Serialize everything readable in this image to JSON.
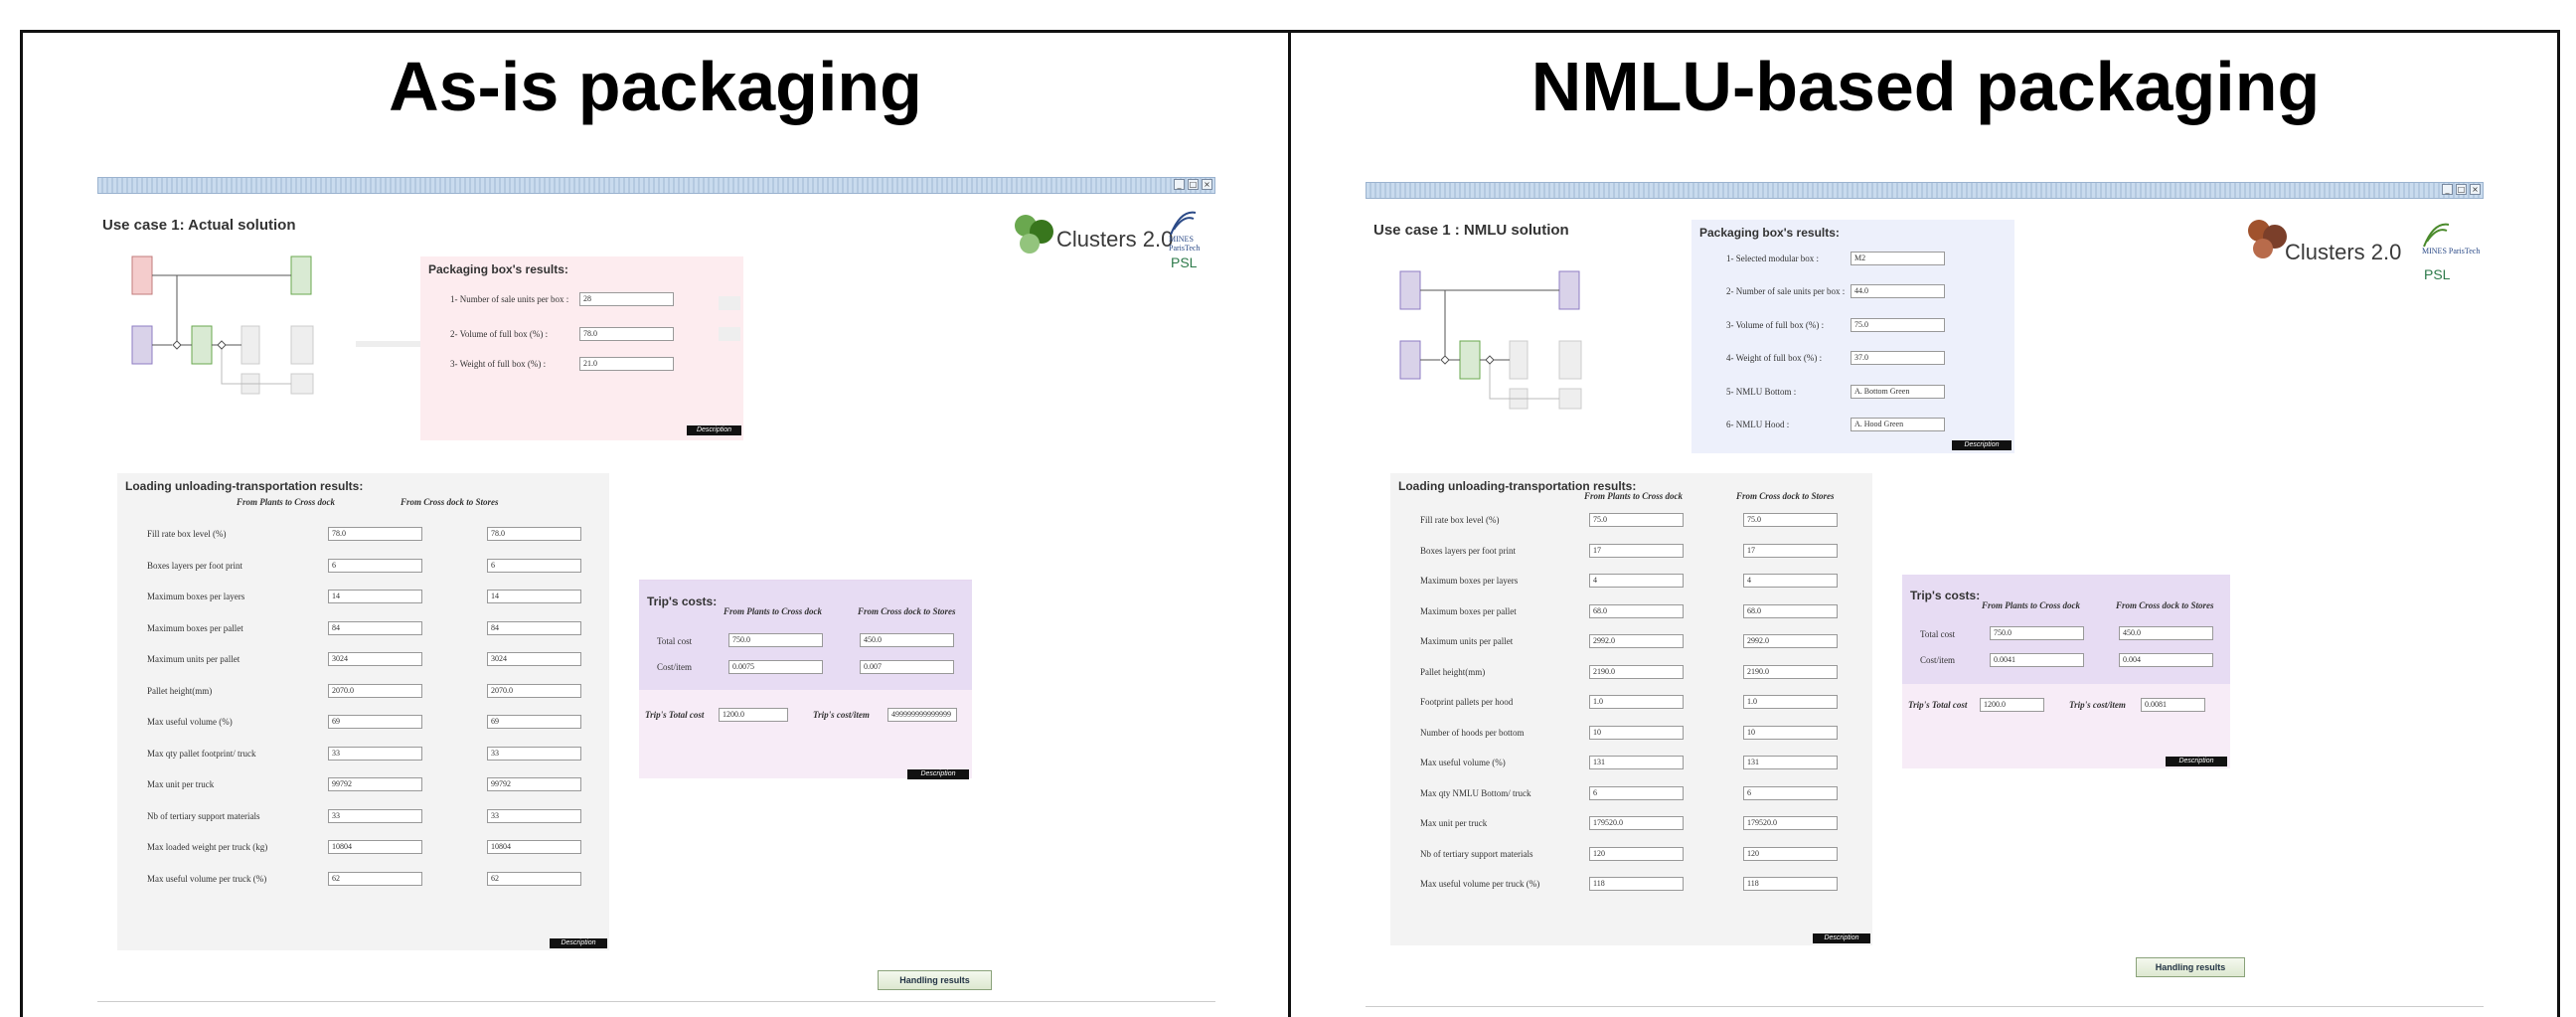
{
  "left": {
    "title": "As-is packaging",
    "use_case": "Use case 1: Actual solution",
    "logo": "Clusters 2.0",
    "mines": "MINES ParisTech",
    "psl": "PSL",
    "packaging": {
      "title": "Packaging box's results:",
      "rows": [
        {
          "label": "1- Number of sale units per box :",
          "value": "28"
        },
        {
          "label": "2- Volume of full box (%) :",
          "value": "78.0"
        },
        {
          "label": "3- Weight of full box (%) :",
          "value": "21.0"
        }
      ],
      "description": "Description"
    },
    "loading": {
      "title": "Loading unloading-transportation results:",
      "col1": "From Plants to Cross dock",
      "col2": "From Cross dock to Stores",
      "rows": [
        {
          "label": "Fill rate box level (%)",
          "v1": "78.0",
          "v2": "78.0"
        },
        {
          "label": "Boxes layers per foot print",
          "v1": "6",
          "v2": "6"
        },
        {
          "label": "Maximum boxes per layers",
          "v1": "14",
          "v2": "14"
        },
        {
          "label": "Maximum boxes per pallet",
          "v1": "84",
          "v2": "84"
        },
        {
          "label": "Maximum units per pallet",
          "v1": "3024",
          "v2": "3024"
        },
        {
          "label": "Pallet height(mm)",
          "v1": "2070.0",
          "v2": "2070.0"
        },
        {
          "label": "Max useful volume (%)",
          "v1": "69",
          "v2": "69"
        },
        {
          "label": "Max qty pallet footprint/ truck",
          "v1": "33",
          "v2": "33"
        },
        {
          "label": "Max unit per truck",
          "v1": "99792",
          "v2": "99792"
        },
        {
          "label": "Nb of tertiary support materials",
          "v1": "33",
          "v2": "33"
        },
        {
          "label": "Max loaded weight per truck (kg)",
          "v1": "10804",
          "v2": "10804"
        },
        {
          "label": "Max useful volume per truck (%)",
          "v1": "62",
          "v2": "62"
        }
      ],
      "description": "Description"
    },
    "trip": {
      "title": "Trip's costs:",
      "col1": "From Plants to Cross dock",
      "col2": "From Cross dock to Stores",
      "total_cost_label": "Total cost",
      "total_cost_1": "750.0",
      "total_cost_2": "450.0",
      "cost_item_label": "Cost/item",
      "cost_item_1": "0.0075",
      "cost_item_2": "0.007",
      "trip_total_label": "Trip's Total cost",
      "trip_total_value": "1200.0",
      "trip_item_label": "Trip's cost/item",
      "trip_item_value": "499999999999999",
      "description": "Description"
    },
    "handling_button": "Handling results"
  },
  "right": {
    "title": "NMLU-based packaging",
    "use_case": "Use case 1 : NMLU solution",
    "logo": "Clusters 2.0",
    "mines": "MINES ParisTech",
    "psl": "PSL",
    "packaging": {
      "title": "Packaging box's results:",
      "rows": [
        {
          "label": "1- Selected modular box :",
          "value": "M2"
        },
        {
          "label": "2- Number of sale units per box :",
          "value": "44.0"
        },
        {
          "label": "3- Volume of full box (%) :",
          "value": "75.0"
        },
        {
          "label": "4- Weight of full box (%) :",
          "value": "37.0"
        },
        {
          "label": "5- NMLU Bottom :",
          "value": "A. Bottom Green"
        },
        {
          "label": "6- NMLU Hood :",
          "value": "A. Hood Green"
        }
      ],
      "description": "Description"
    },
    "loading": {
      "title": "Loading unloading-transportation results:",
      "col1": "From Plants to Cross dock",
      "col2": "From Cross dock to Stores",
      "rows": [
        {
          "label": "Fill rate box level (%)",
          "v1": "75.0",
          "v2": "75.0"
        },
        {
          "label": "Boxes layers per foot print",
          "v1": "17",
          "v2": "17"
        },
        {
          "label": "Maximum boxes per layers",
          "v1": "4",
          "v2": "4"
        },
        {
          "label": "Maximum boxes per pallet",
          "v1": "68.0",
          "v2": "68.0"
        },
        {
          "label": "Maximum units per pallet",
          "v1": "2992.0",
          "v2": "2992.0"
        },
        {
          "label": "Pallet height(mm)",
          "v1": "2190.0",
          "v2": "2190.0"
        },
        {
          "label": "Footprint pallets per hood",
          "v1": "1.0",
          "v2": "1.0"
        },
        {
          "label": "Number of hoods per bottom",
          "v1": "10",
          "v2": "10"
        },
        {
          "label": "Max useful volume (%)",
          "v1": "131",
          "v2": "131"
        },
        {
          "label": "Max qty NMLU Bottom/ truck",
          "v1": "6",
          "v2": "6"
        },
        {
          "label": "Max unit per truck",
          "v1": "179520.0",
          "v2": "179520.0"
        },
        {
          "label": "Nb of tertiary support materials",
          "v1": "120",
          "v2": "120"
        },
        {
          "label": "Max useful volume per truck (%)",
          "v1": "118",
          "v2": "118"
        }
      ],
      "description": "Description"
    },
    "trip": {
      "title": "Trip's costs:",
      "col1": "From Plants to Cross dock",
      "col2": "From Cross dock to Stores",
      "total_cost_label": "Total cost",
      "total_cost_1": "750.0",
      "total_cost_2": "450.0",
      "cost_item_label": "Cost/item",
      "cost_item_1": "0.0041",
      "cost_item_2": "0.004",
      "trip_total_label": "Trip's Total cost",
      "trip_total_value": "1200.0",
      "trip_item_label": "Trip's cost/item",
      "trip_item_value": "0.0081",
      "description": "Description"
    },
    "handling_button": "Handling results"
  }
}
